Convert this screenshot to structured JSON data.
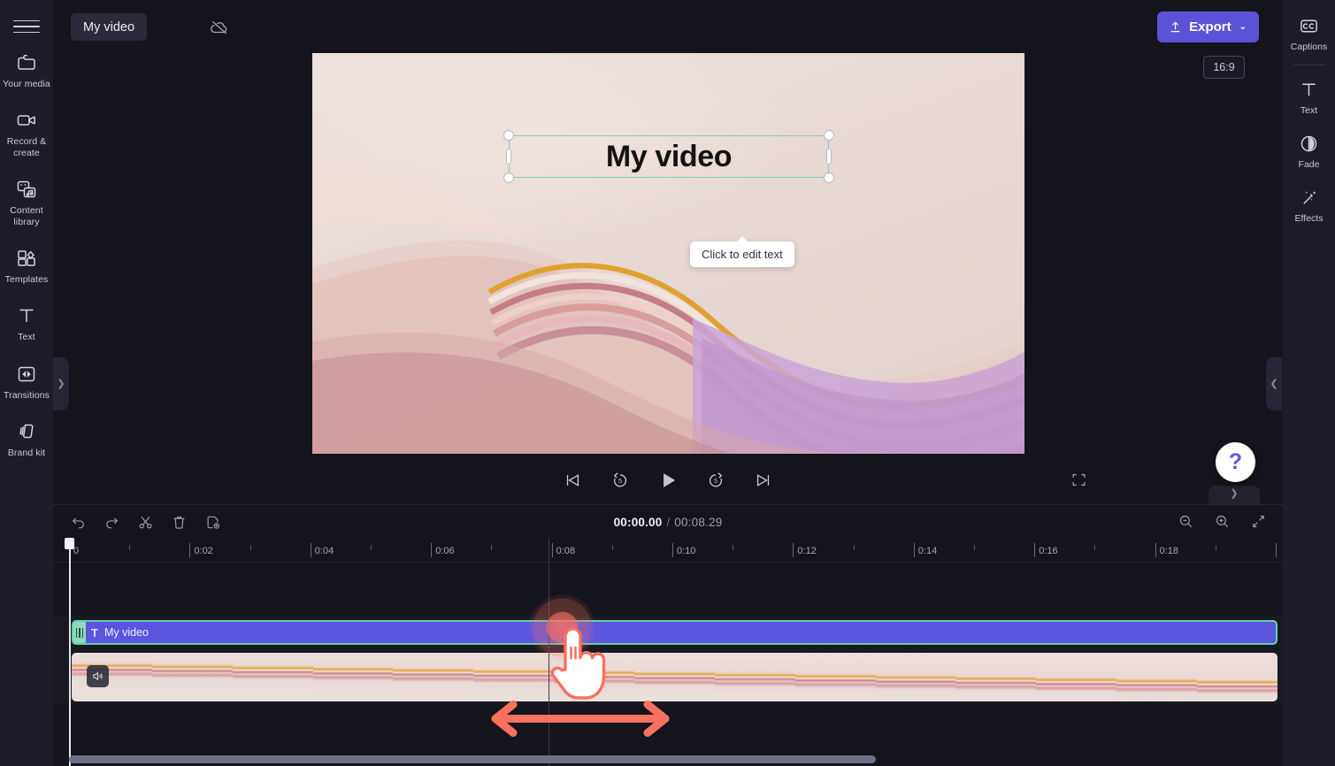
{
  "app": {
    "title": "My video",
    "menu_icon": "hamburger-icon",
    "cloud_icon": "cloud-offline-icon"
  },
  "left_rail": {
    "items": [
      {
        "label": "Your media",
        "icon": "folder-icon"
      },
      {
        "label": "Record & create",
        "icon": "video-camera-icon"
      },
      {
        "label": "Content library",
        "icon": "content-library-icon"
      },
      {
        "label": "Templates",
        "icon": "templates-icon"
      },
      {
        "label": "Text",
        "icon": "text-t-icon"
      },
      {
        "label": "Transitions",
        "icon": "transitions-icon"
      },
      {
        "label": "Brand kit",
        "icon": "brand-kit-icon"
      }
    ],
    "collapse_icon": "chevron-right-icon"
  },
  "right_rail": {
    "items": [
      {
        "label": "Captions",
        "icon": "cc-icon"
      },
      {
        "label": "Text",
        "icon": "text-t-icon"
      },
      {
        "label": "Fade",
        "icon": "fade-circle-icon"
      },
      {
        "label": "Effects",
        "icon": "magic-wand-icon"
      }
    ],
    "collapse_icon": "chevron-left-icon"
  },
  "toolbar": {
    "export_label": "Export",
    "export_icon": "upload-icon",
    "export_caret": "⌄",
    "export_color": "#5b52d8"
  },
  "preview": {
    "aspect_ratio": "16:9",
    "overlay_text": "My video",
    "tooltip": "Click to edit text",
    "selection_color": "#7fcfae",
    "help_icon": "question-mark-icon",
    "panel_chevron": "chevron-down-icon",
    "controls": [
      {
        "name": "skip-to-start",
        "icon": "skip-previous-icon"
      },
      {
        "name": "rewind-5",
        "icon": "replay-5-icon",
        "label": "5"
      },
      {
        "name": "play",
        "icon": "play-icon"
      },
      {
        "name": "forward-5",
        "icon": "forward-5-icon",
        "label": "5"
      },
      {
        "name": "skip-to-end",
        "icon": "skip-next-icon"
      }
    ],
    "fullscreen_icon": "fullscreen-icon"
  },
  "timeline": {
    "tools": [
      {
        "name": "undo",
        "icon": "undo-arrow-icon"
      },
      {
        "name": "redo",
        "icon": "redo-arrow-icon"
      },
      {
        "name": "split",
        "icon": "scissors-icon"
      },
      {
        "name": "delete",
        "icon": "trash-icon"
      },
      {
        "name": "duplicate",
        "icon": "duplicate-page-icon"
      }
    ],
    "current_time": "00:00.00",
    "separator": "/",
    "total_time": "00:08.29",
    "zoom_tools": [
      {
        "name": "zoom-out",
        "icon": "zoom-out-icon"
      },
      {
        "name": "zoom-in",
        "icon": "zoom-in-icon"
      },
      {
        "name": "fit-to-screen",
        "icon": "fit-screen-icon"
      }
    ],
    "ruler_labels": [
      "0",
      "0:02",
      "0:04",
      "0:06",
      "0:08",
      "0:10",
      "0:12",
      "0:14",
      "0:16",
      "0:18"
    ],
    "text_clip": {
      "label": "My video",
      "icon": "text-clip-icon",
      "color": "#5b55e0",
      "border_color": "#63d2a6"
    },
    "video_clip": {
      "volume_icon": "speaker-icon"
    }
  },
  "annotations": {
    "cursor_icon": "pointing-hand-cursor",
    "drag_arrow_icon": "double-headed-arrow-icon",
    "accent_color": "#f87060"
  }
}
